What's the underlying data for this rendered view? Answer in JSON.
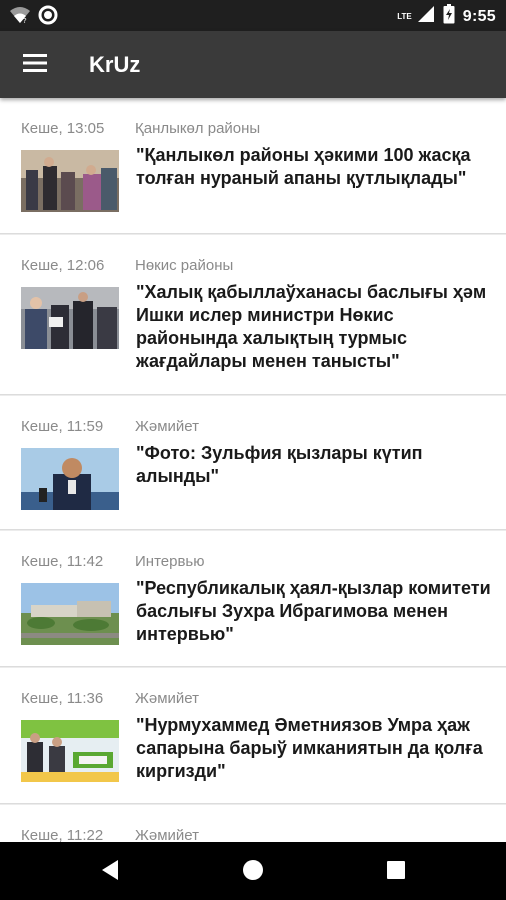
{
  "status_bar": {
    "time": "9:55",
    "network_label": "LTE",
    "icons": [
      "wifi-icon",
      "circle-notification-icon",
      "signal-icon",
      "battery-icon"
    ]
  },
  "app_bar": {
    "title": "KrUz",
    "menu_icon": "hamburger-menu-icon"
  },
  "articles": [
    {
      "time": "Кеше, 13:05",
      "category": "Қанлыкөл районы",
      "headline": "\"Қанлыкөл районы ҳәкими 100 жасқа толған нураный апаны қутлықлады\""
    },
    {
      "time": "Кеше, 12:06",
      "category": "Нөкис районы",
      "headline": "\"Халық қабыллаўханасы баслығы ҳәм Ишки ислер министри Нөкис районында халықтың турмыс жағдайлары менен танысты\""
    },
    {
      "time": "Кеше, 11:59",
      "category": "Жәмийет",
      "headline": "\"Фото: Зульфия қызлары күтип алынды\""
    },
    {
      "time": "Кеше, 11:42",
      "category": "Интервью",
      "headline": "\"Республикалық ҳаял-қызлар комитети баслығы Зухра Ибрагимова менен интервью\""
    },
    {
      "time": "Кеше, 11:36",
      "category": "Жәмийет",
      "headline": "\"Нурмухаммед Әметниязов Умра ҳаж сапарына барыў имканиятын да қолға киргизди\""
    },
    {
      "time": "Кеше, 11:22",
      "category": "Жәмийет",
      "headline": ""
    }
  ],
  "nav_bar": {
    "icons": [
      "back-icon",
      "home-icon",
      "recents-icon"
    ]
  },
  "colors": {
    "status_bar": "#1f1f1f",
    "app_bar": "#3a3a3a",
    "background": "#ececec",
    "card": "#ffffff",
    "meta_text": "#8a8a8a",
    "headline_text": "#1a1a1a"
  }
}
